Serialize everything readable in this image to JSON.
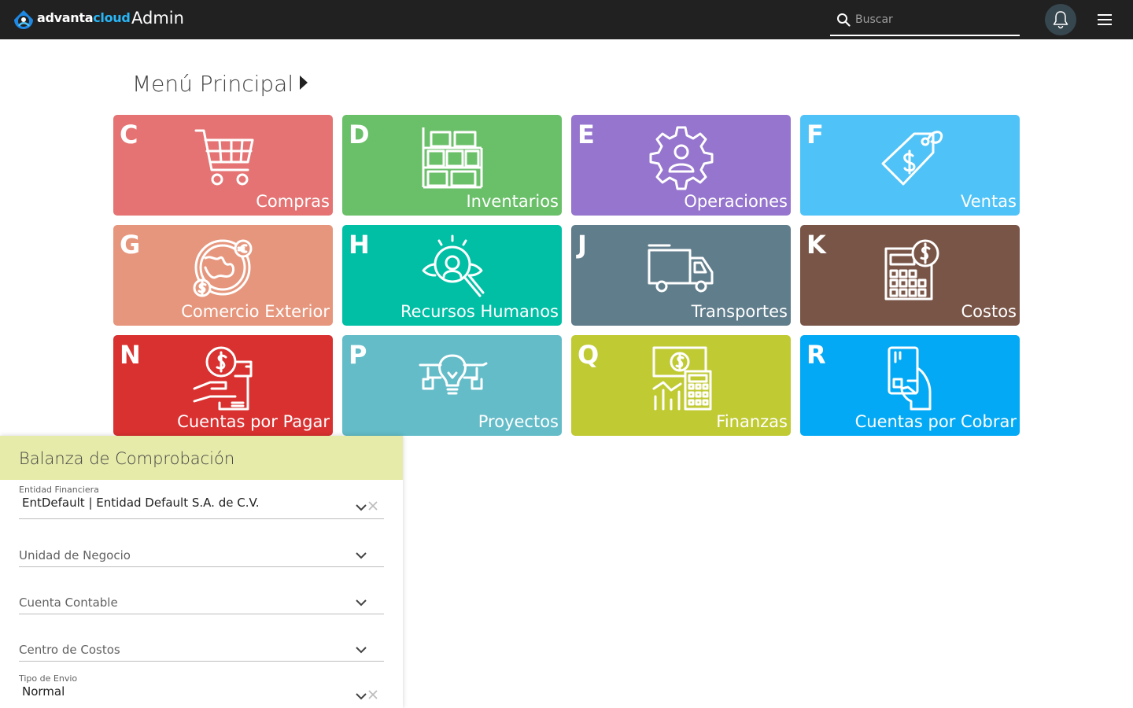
{
  "header": {
    "logo_text_main": "advanta",
    "logo_text_accent": "cloud",
    "title": "Admin",
    "search_placeholder": "Buscar",
    "bell_icon": "bell-icon",
    "menu_icon": "hamburger-menu-icon"
  },
  "main": {
    "section_title": "Menú Principal",
    "tiles": [
      {
        "letter": "C",
        "label": "Compras",
        "icon": "shopping-cart-icon",
        "color": "#e57373"
      },
      {
        "letter": "D",
        "label": "Inventarios",
        "icon": "warehouse-shelves-icon",
        "color": "#6abf69"
      },
      {
        "letter": "E",
        "label": "Operaciones",
        "icon": "gear-person-icon",
        "color": "#9575cd"
      },
      {
        "letter": "F",
        "label": "Ventas",
        "icon": "price-tag-icon",
        "color": "#4fc3f7"
      },
      {
        "letter": "G",
        "label": "Comercio Exterior",
        "icon": "globe-currency-icon",
        "color": "#e6967c"
      },
      {
        "letter": "H",
        "label": "Recursos Humanos",
        "icon": "magnifier-person-icon",
        "color": "#00bfa5"
      },
      {
        "letter": "J",
        "label": "Transportes",
        "icon": "truck-icon",
        "color": "#607d8b"
      },
      {
        "letter": "K",
        "label": "Costos",
        "icon": "calculator-dollar-icon",
        "color": "#795548"
      },
      {
        "letter": "N",
        "label": "Cuentas por Pagar",
        "icon": "hand-coin-icon",
        "color": "#d93030"
      },
      {
        "letter": "P",
        "label": "Proyectos",
        "icon": "lightbulb-project-icon",
        "color": "#63bcc8"
      },
      {
        "letter": "Q",
        "label": "Finanzas",
        "icon": "finance-calculator-icon",
        "color": "#c0ca33"
      },
      {
        "letter": "R",
        "label": "Cuentas por Cobrar",
        "icon": "hand-card-icon",
        "color": "#03a9f4"
      }
    ]
  },
  "panel": {
    "title": "Balanza de Comprobación",
    "header_color": "#e6ebaa",
    "fields": [
      {
        "label": "Entidad Financiera",
        "value": "EntDefault | Entidad Default S.A. de C.V."
      },
      {
        "placeholder": "Unidad de Negocio"
      },
      {
        "placeholder": "Cuenta Contable"
      },
      {
        "placeholder": "Centro de Costos"
      },
      {
        "label": "Tipo de Envio",
        "value": "Normal"
      }
    ]
  }
}
